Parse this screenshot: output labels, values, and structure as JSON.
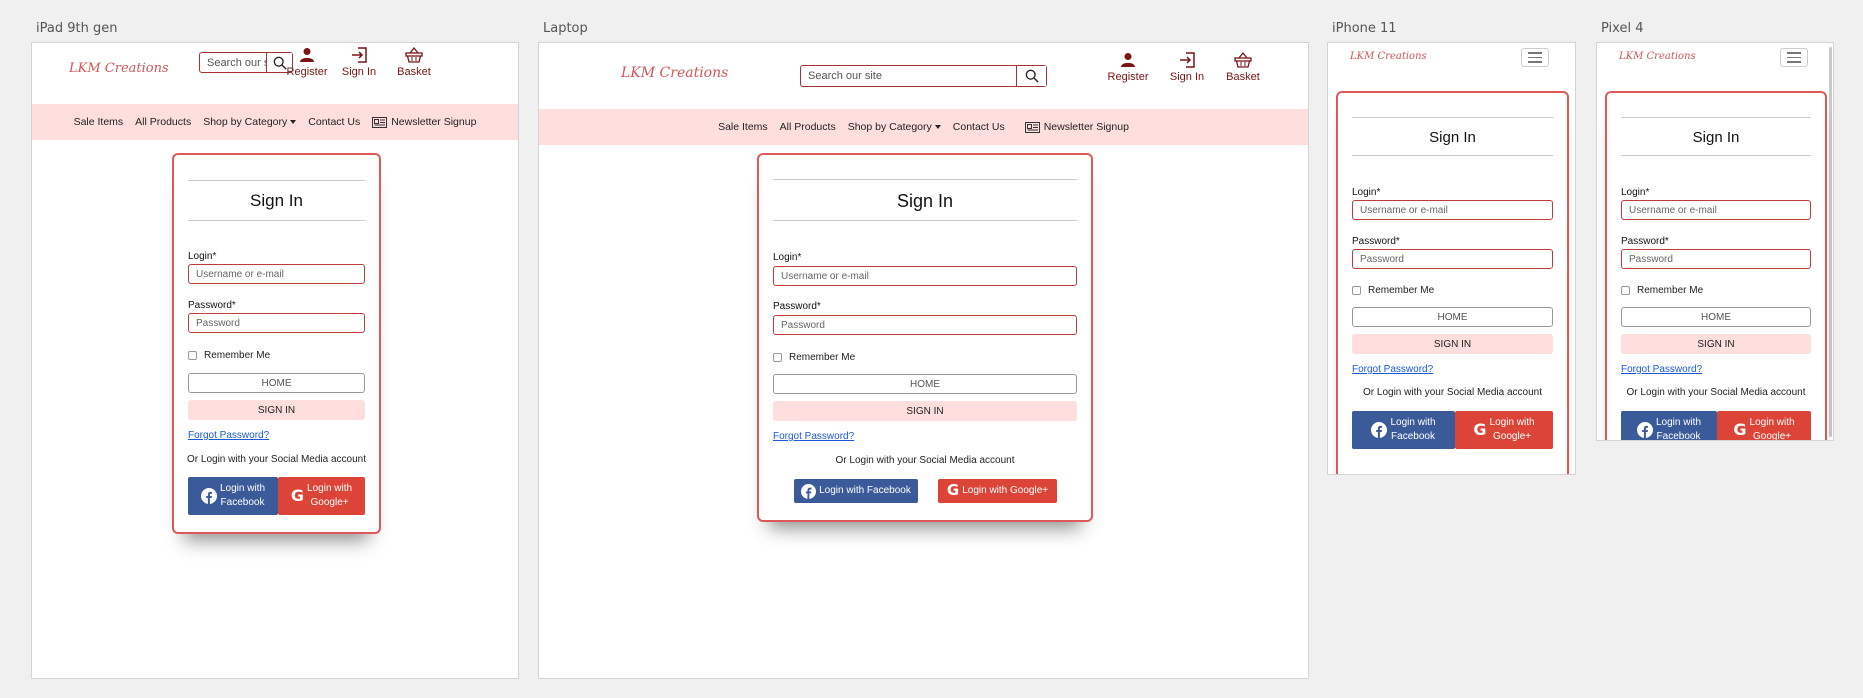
{
  "frames": {
    "ipad": "iPad 9th gen",
    "laptop": "Laptop",
    "iphone": "iPhone 11",
    "pixel": "Pixel 4"
  },
  "brand": {
    "logo_text": "LKM Creations",
    "accent": "#d25656",
    "dark_red": "#7a1414",
    "nav_bg": "#ffdede"
  },
  "search": {
    "placeholder_ipad": "Search our site",
    "placeholder_laptop": "Search our site"
  },
  "header_icons": {
    "register": {
      "label": "Register",
      "icon": "user-icon"
    },
    "signin": {
      "label": "Sign In",
      "icon": "sign-in-icon"
    },
    "basket": {
      "label": "Basket",
      "icon": "basket-icon"
    }
  },
  "nav": {
    "sale": "Sale Items",
    "all": "All Products",
    "category": "Shop by Category",
    "contact": "Contact Us",
    "newsletter": "Newsletter Signup"
  },
  "signin_form": {
    "title": "Sign In",
    "login_label": "Login*",
    "login_placeholder": "Username or e-mail",
    "password_label": "Password*",
    "password_placeholder": "Password",
    "remember": "Remember Me",
    "home_button": "HOME",
    "signin_button": "SIGN IN",
    "forgot": "Forgot Password?",
    "social_text": "Or Login with your Social Media account",
    "facebook": "Login with Facebook",
    "google": "Login with Google+",
    "facebook_l1": "Login with",
    "facebook_l2": "Facebook",
    "google_l1": "Login with",
    "google_l2": "Google+",
    "facebook_color": "#3b5a9a",
    "google_color": "#db4437"
  }
}
